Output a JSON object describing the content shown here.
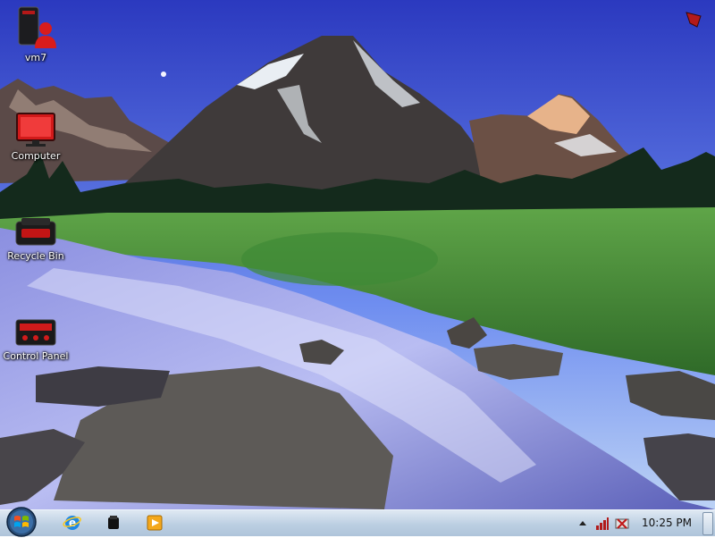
{
  "desktop": {
    "icons": [
      {
        "label": "vm7",
        "icon": "user-computer-icon"
      },
      {
        "label": "Computer",
        "icon": "computer-monitor-icon"
      },
      {
        "label": "Recycle Bin",
        "icon": "recycle-bin-icon"
      },
      {
        "label": "Control Panel",
        "icon": "control-panel-icon"
      }
    ]
  },
  "taskbar": {
    "start": "start-orb-icon",
    "pinned": [
      "internet-explorer-icon",
      "black-box-icon",
      "media-player-icon"
    ],
    "tray_icons": [
      "show-hidden-icons-arrow",
      "network-icon",
      "volume-icon"
    ],
    "clock": "10:25 PM"
  },
  "colors": {
    "taskbar": "#c7d7e8",
    "sky_top": "#2d3cc0",
    "grass": "#4e9a3e",
    "water": "#7f80d8"
  }
}
